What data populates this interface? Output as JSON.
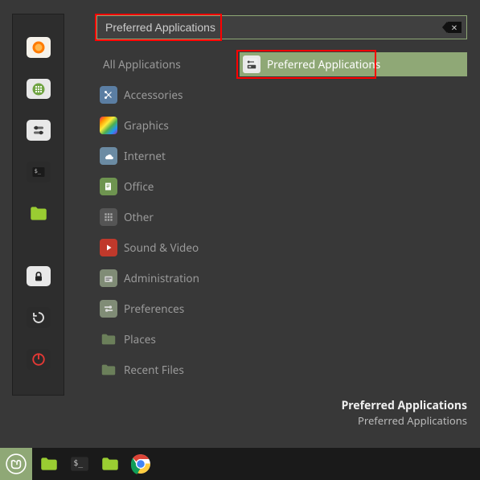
{
  "search": {
    "value": "Preferred Applications"
  },
  "categories": {
    "all": "All Applications",
    "items": [
      {
        "label": "Accessories"
      },
      {
        "label": "Graphics"
      },
      {
        "label": "Internet"
      },
      {
        "label": "Office"
      },
      {
        "label": "Other"
      },
      {
        "label": "Sound & Video"
      },
      {
        "label": "Administration"
      },
      {
        "label": "Preferences"
      },
      {
        "label": "Places"
      },
      {
        "label": "Recent Files"
      }
    ]
  },
  "results": {
    "items": [
      {
        "label": "Preferred Applications"
      }
    ]
  },
  "selected_app": {
    "name": "Preferred Applications",
    "desc": "Preferred Applications"
  }
}
